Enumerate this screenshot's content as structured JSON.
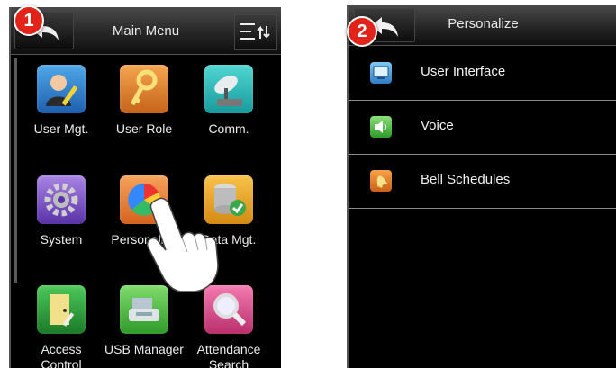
{
  "screen1": {
    "badge": "1",
    "title": "Main Menu",
    "items": [
      {
        "label": "User Mgt.",
        "icon": "user-mgt-icon"
      },
      {
        "label": "User Role",
        "icon": "key-icon"
      },
      {
        "label": "Comm.",
        "icon": "satellite-icon"
      },
      {
        "label": "System",
        "icon": "gear-icon"
      },
      {
        "label": "Personalize",
        "icon": "color-wheel-icon"
      },
      {
        "label": "Data Mgt.",
        "icon": "database-icon"
      },
      {
        "label": "Access Control",
        "icon": "door-icon"
      },
      {
        "label": "USB Manager",
        "icon": "usb-drive-icon"
      },
      {
        "label": "Attendance Search",
        "icon": "magnifier-icon"
      }
    ]
  },
  "screen2": {
    "badge": "2",
    "title": "Personalize",
    "items": [
      {
        "label": "User Interface",
        "icon": "monitor-icon"
      },
      {
        "label": "Voice",
        "icon": "speaker-icon"
      },
      {
        "label": "Bell Schedules",
        "icon": "bell-icon"
      }
    ]
  },
  "colors": {
    "badge": "#e2231a",
    "panel_background": "#000000"
  }
}
